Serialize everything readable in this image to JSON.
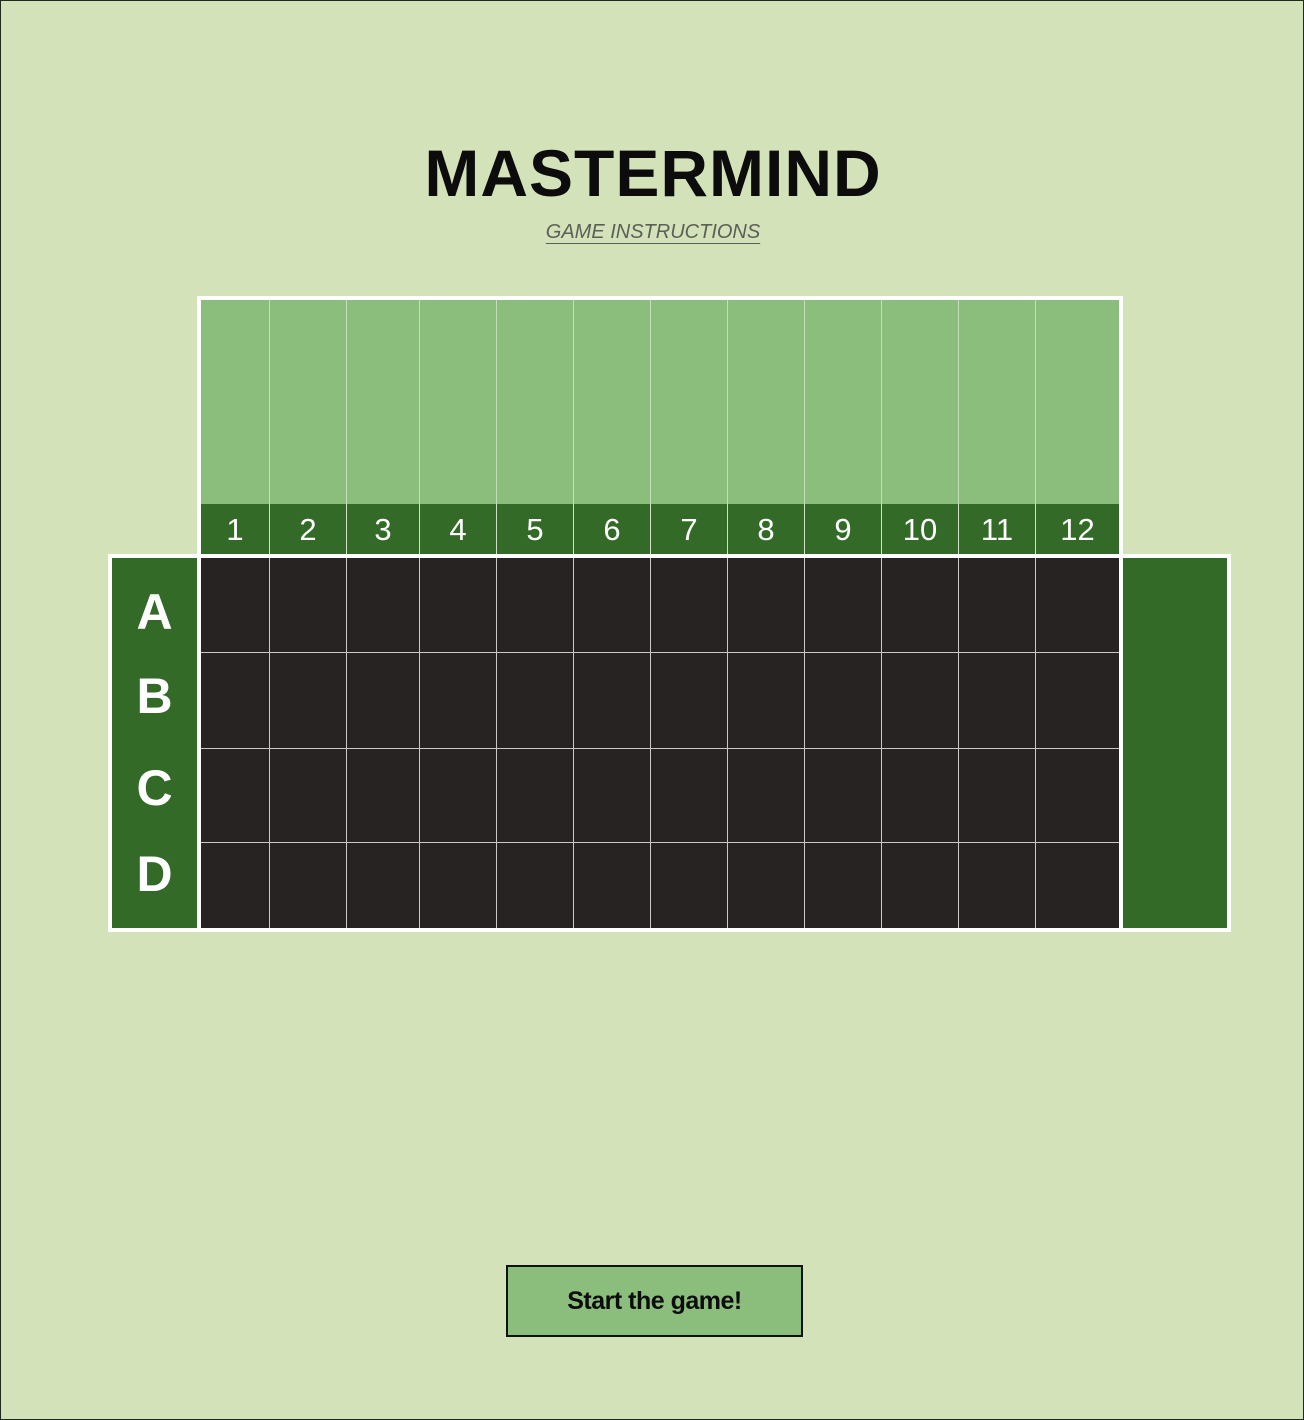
{
  "title": "MASTERMIND",
  "instructions_link": "GAME INSTRUCTIONS",
  "columns": [
    "1",
    "2",
    "3",
    "4",
    "5",
    "6",
    "7",
    "8",
    "9",
    "10",
    "11",
    "12"
  ],
  "rows": [
    "A",
    "B",
    "C",
    "D"
  ],
  "start_button": "Start the game!",
  "colors": {
    "background": "#d3e2b8",
    "light_green": "#8bbd7d",
    "dark_green": "#336a28",
    "board_cell": "#262322",
    "border": "#ffffff"
  }
}
